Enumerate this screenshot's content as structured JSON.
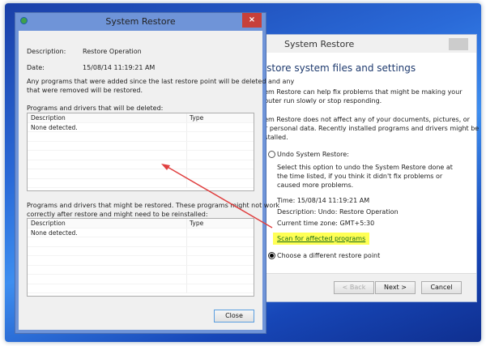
{
  "back_window": {
    "title": "System Restore",
    "heading": "Restore system files and settings",
    "para1_line1": "System Restore can help fix problems that might be making your",
    "para1_line2": "computer run slowly or stop responding.",
    "para2_line1": "System Restore does not affect any of your documents, pictures, or",
    "para2_line2": "other personal data. Recently installed programs and drivers might be",
    "para2_line3": "uninstalled.",
    "option_undo": "Undo System Restore:",
    "undo_desc_1": "Select this option to undo the System Restore done at",
    "undo_desc_2": "the time listed, if you think it didn't fix problems or",
    "undo_desc_3": "caused more problems.",
    "time": "Time: 15/08/14 11:19:21 AM",
    "description": "Description: Undo: Restore Operation",
    "timezone": "Current time zone: GMT+5:30",
    "scan_link": "Scan for affected programs",
    "option_choose": "Choose a different restore point",
    "selected_option": "Choose a different restore point",
    "back_label": "< Back",
    "next_label": "Next >",
    "cancel_label": "Cancel",
    "close_glyph": "×"
  },
  "front_window": {
    "title": "System Restore",
    "close_glyph": "×",
    "description_label": "Description:",
    "description_value": "Restore Operation",
    "date_label": "Date:",
    "date_value": "15/08/14 11:19:21 AM",
    "info_line1": "Any programs that were added since the last restore point will be deleted and any",
    "info_line2": "that were removed will be restored.",
    "deleted_label": "Programs and drivers that will be deleted:",
    "restored_label_1": "Programs and drivers that might be restored. These programs might not work",
    "restored_label_2": "correctly after restore and might need to be reinstalled:",
    "table_headers": [
      "Description",
      "Type"
    ],
    "deleted_rows": [
      [
        "None detected.",
        ""
      ]
    ],
    "restored_rows": [
      [
        "None detected.",
        ""
      ]
    ],
    "close_button": "Close"
  },
  "colors": {
    "highlight": "#ffff55",
    "arrow": "#e04040",
    "titlebar": "#6f94d8",
    "close": "#c7403a"
  }
}
